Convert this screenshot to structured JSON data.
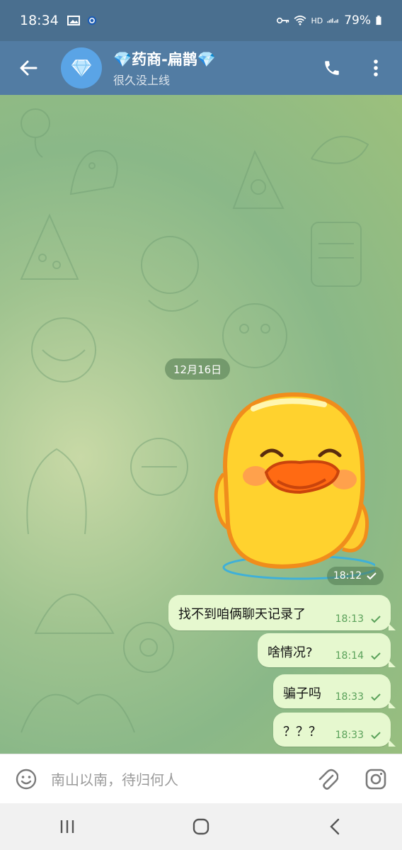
{
  "status_bar": {
    "time": "18:34",
    "network_label": "HD",
    "battery": "79%"
  },
  "header": {
    "title": "💎药商-扁鹊💎",
    "subtitle": "很久没上线",
    "back_icon": "arrow-left-icon",
    "call_icon": "phone-icon",
    "menu_icon": "more-vertical-icon",
    "avatar_icon": "diamond-icon"
  },
  "chat": {
    "date_chip": "12月16日",
    "sticker": {
      "description_icon": "duck-sticker",
      "time": "18:12"
    },
    "messages": [
      {
        "text": "找不到咱俩聊天记录了",
        "time": "18:13"
      },
      {
        "text": "啥情况?",
        "time": "18:14"
      },
      {
        "text": "骗子吗",
        "time": "18:33"
      },
      {
        "text": "？？？",
        "time": "18:33"
      }
    ]
  },
  "composer": {
    "placeholder": "南山以南，待归何人",
    "emoji_icon": "emoji-icon",
    "attach_icon": "paperclip-icon",
    "camera_icon": "instagram-camera-icon"
  },
  "colors": {
    "header_bg": "#527ca3",
    "status_bg": "#4a6f8f",
    "bubble_bg": "#e6f8cf",
    "check_color": "#5aa15a"
  }
}
